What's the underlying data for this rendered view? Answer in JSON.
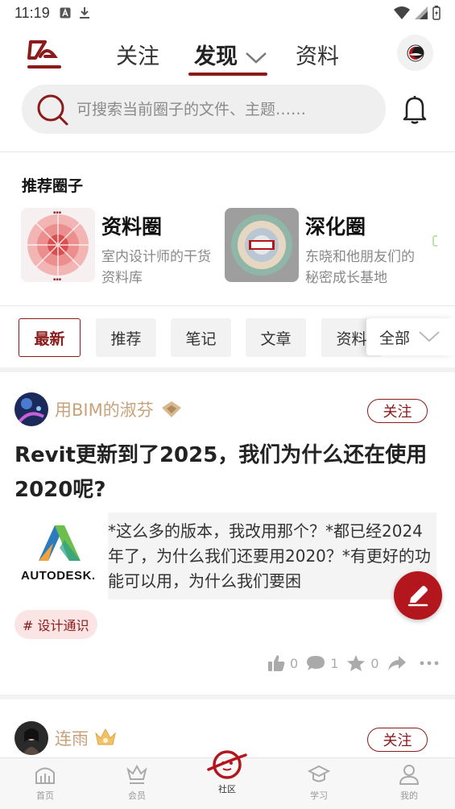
{
  "status_bar": {
    "time": "11:19"
  },
  "header": {
    "tabs": [
      {
        "label": "关注"
      },
      {
        "label": "发现"
      },
      {
        "label": "资料"
      }
    ]
  },
  "search": {
    "placeholder": "可搜索当前圈子的文件、主题……"
  },
  "recommended": {
    "title": "推荐圈子",
    "circles": [
      {
        "name": "资料圈",
        "desc": "室内设计师的干货资料库"
      },
      {
        "name": "深化圈",
        "desc": "东晓和他朋友们的秘密成长基地"
      }
    ]
  },
  "filters": {
    "chips": [
      {
        "label": "最新"
      },
      {
        "label": "推荐"
      },
      {
        "label": "笔记"
      },
      {
        "label": "文章"
      },
      {
        "label": "资料"
      }
    ],
    "all_label": "全部"
  },
  "posts": [
    {
      "author": "用BIM的淑芬",
      "follow_label": "关注",
      "title": "Revit更新到了2025，我们为什么还在使用2020呢?",
      "logo_text": "AUTODESK.",
      "excerpt": "*这么多的版本，我改用那个？*都已经2024年了，为什么我们还要用2020？*有更好的功能可以用，为什么我们要困",
      "tag": "# 设计通识",
      "likes": "0",
      "comments": "1",
      "favorites": "0"
    },
    {
      "author": "连雨",
      "follow_label": "关注"
    }
  ],
  "bottom_nav": [
    {
      "label": "首页"
    },
    {
      "label": "会员"
    },
    {
      "label": "社区"
    },
    {
      "label": "学习"
    },
    {
      "label": "我的"
    }
  ],
  "colors": {
    "accent": "#8b1a1a",
    "fab": "#b3161c",
    "author_name": "#c8a27a"
  }
}
